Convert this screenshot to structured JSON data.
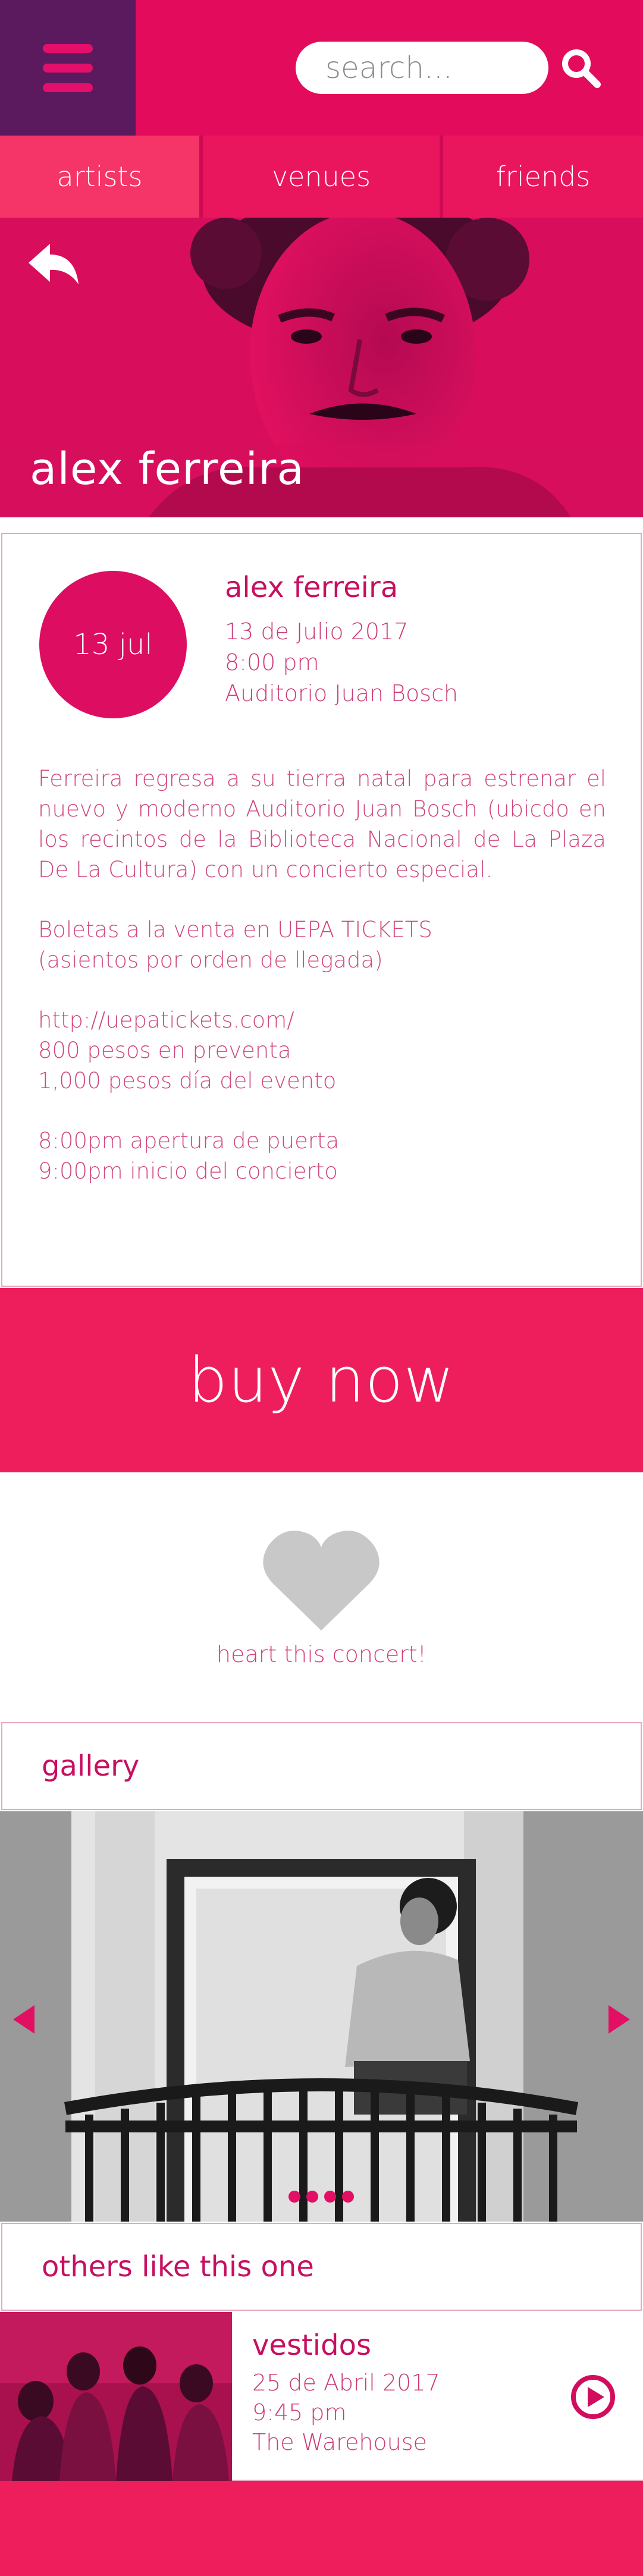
{
  "header": {
    "search_placeholder": "search...",
    "icons": {
      "menu": "hamburger-menu-icon",
      "search": "search-icon"
    }
  },
  "nav": {
    "tabs": [
      {
        "label": "artists",
        "active": true
      },
      {
        "label": "venues",
        "active": false
      },
      {
        "label": "friends",
        "active": false
      }
    ]
  },
  "hero": {
    "title": "alex ferreira",
    "back_icon": "back-arrow-icon"
  },
  "event": {
    "date_badge": "13 jul",
    "name": "alex ferreira",
    "date": "13 de Julio 2017",
    "time": "8:00 pm",
    "venue": "Auditorio Juan Bosch",
    "description": {
      "intro": "Ferreira regresa a su tierra natal para estrenar el nuevo y moderno Auditorio Juan Bosch (ubicdo en los recintos de la Biblioteca Nacional de La Plaza De La Cultura) con un concierto especial.",
      "tickets_line1": "Boletas a la venta en UEPA TICKETS",
      "tickets_line2": "(asientos por orden de llegada)",
      "url": "http://uepatickets.com/",
      "presale": "800 pesos en preventa",
      "day_price": "1,000 pesos día del evento",
      "doors": "8:00pm apertura de puerta",
      "start": "9:00pm inicio del concierto"
    }
  },
  "buy": {
    "label": "buy now"
  },
  "favorite": {
    "label": "heart this concert!",
    "icon": "heart-icon"
  },
  "gallery": {
    "title": "gallery",
    "slide_count": 4,
    "active_slide": 0
  },
  "others": {
    "title": "others like this one",
    "items": [
      {
        "name": "vestidos",
        "date": "25 de Abril 2017",
        "time": "9:45 pm",
        "venue": "The Warehouse"
      }
    ]
  },
  "colors": {
    "primary": "#e30b5c",
    "menu_bg": "#5c1a5e",
    "buy_bg": "#ee1e5d",
    "text_accent": "#c70f60",
    "heart": "#c8c8c8"
  }
}
